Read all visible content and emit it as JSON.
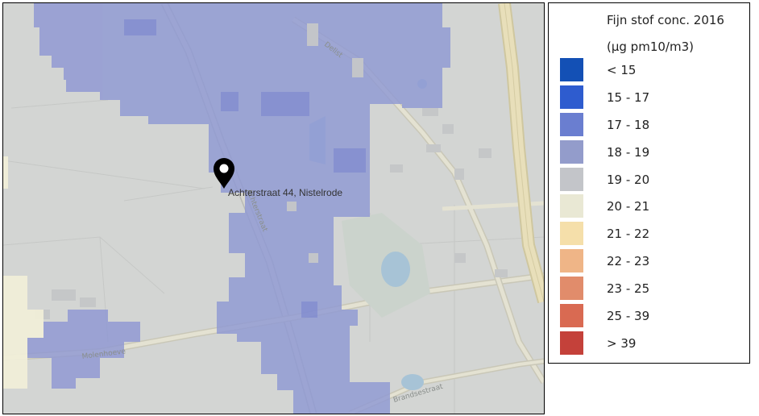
{
  "map": {
    "marker_label": "Achterstraat 44, Nistelrode",
    "streets": {
      "delist": "Delist",
      "achterstraat": "Achterstraat",
      "molenhoeve": "Molenhoeve",
      "brandsestraat": "Brandsestraat"
    },
    "colors": {
      "base": "#d3d5d3",
      "road": "#e4e2d2",
      "road_edge": "#c9c7b7",
      "highway": "#e8dfba",
      "building": "#c5c7c8",
      "water": "#a7c3d6",
      "overlay_18_19": "#959dd2",
      "overlay_17_18": "#7a86cf",
      "overlay_20_21": "#f0eed8",
      "marker": "#000000"
    }
  },
  "legend": {
    "title": "Fijn stof conc. 2016",
    "unit": "(µg pm10/m3)",
    "items": [
      {
        "label": "< 15",
        "color": "#1350b5"
      },
      {
        "label": "15 - 17",
        "color": "#2e5ccf"
      },
      {
        "label": "17 - 18",
        "color": "#6a7ed0"
      },
      {
        "label": "18 - 19",
        "color": "#939ccb"
      },
      {
        "label": "19 - 20",
        "color": "#c3c5c9"
      },
      {
        "label": "20 - 21",
        "color": "#e9e8d4"
      },
      {
        "label": "21 - 22",
        "color": "#f5dfaa"
      },
      {
        "label": "22 - 23",
        "color": "#efb587"
      },
      {
        "label": "23 - 25",
        "color": "#e18c6b"
      },
      {
        "label": "25 - 39",
        "color": "#d96a52"
      },
      {
        "label": "> 39",
        "color": "#c4413a"
      }
    ]
  }
}
